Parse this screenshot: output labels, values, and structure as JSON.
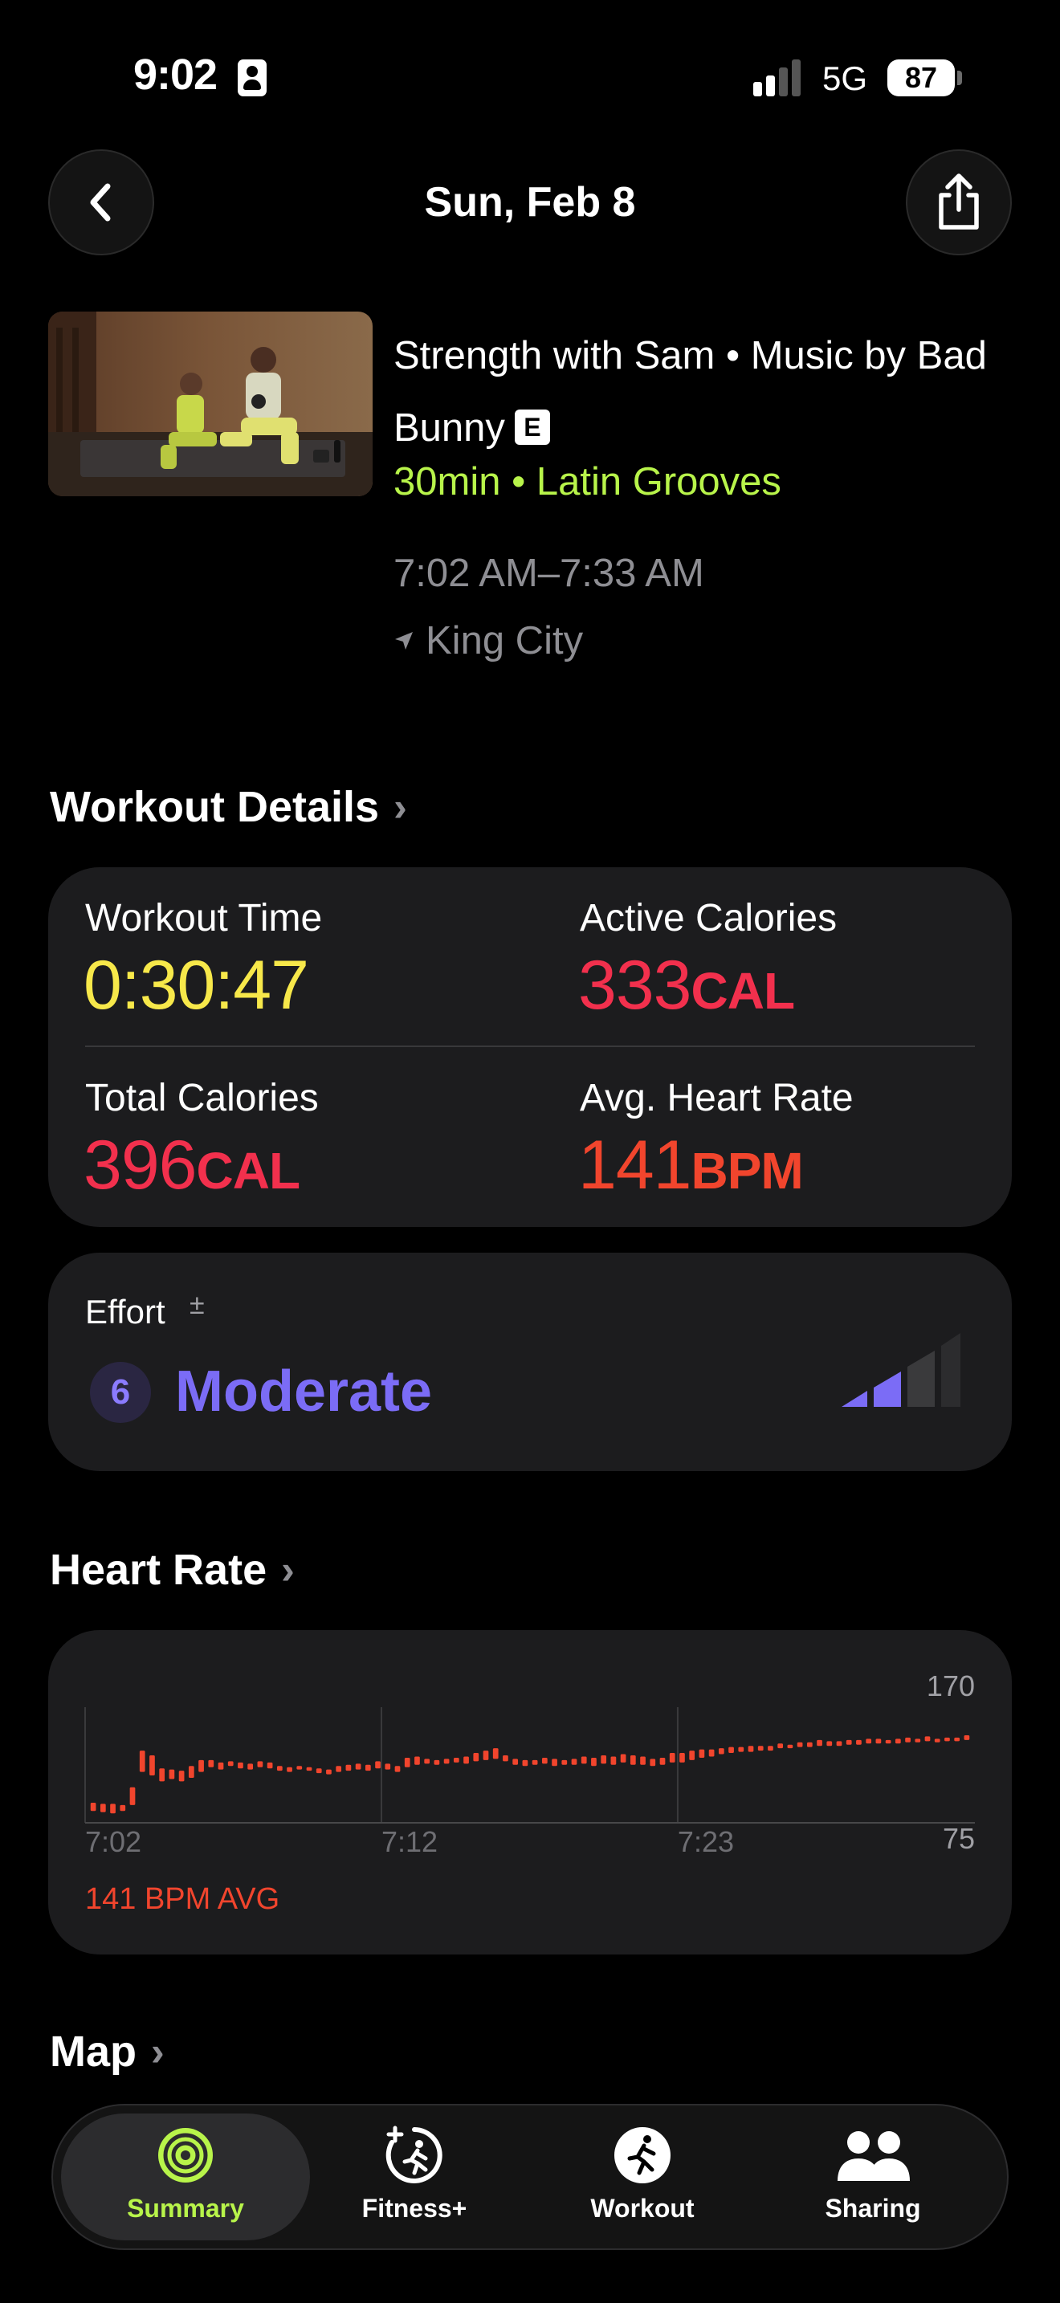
{
  "status": {
    "time": "9:02",
    "network": "5G",
    "battery": "87"
  },
  "header": {
    "title": "Sun, Feb 8"
  },
  "workout": {
    "title": "Strength with Sam • Music by Bad Bunny",
    "explicit_badge": "E",
    "meta": "30min • Latin Grooves",
    "time_range": "7:02 AM–7:33 AM",
    "location": "King City"
  },
  "details": {
    "section_title": "Workout Details",
    "workout_time_label": "Workout Time",
    "workout_time_value": "0:30:47",
    "active_cal_label": "Active Calories",
    "active_cal_value": "333",
    "active_cal_unit": "CAL",
    "total_cal_label": "Total Calories",
    "total_cal_value": "396",
    "total_cal_unit": "CAL",
    "avg_hr_label": "Avg. Heart Rate",
    "avg_hr_value": "141",
    "avg_hr_unit": "BPM"
  },
  "effort": {
    "label": "Effort",
    "symbol": "±",
    "score": "6",
    "level": "Moderate",
    "bars_filled": 2,
    "bars_total": 4
  },
  "heart_rate": {
    "section_title": "Heart Rate",
    "avg_text": "141 BPM AVG",
    "y_max": "170",
    "y_min": "75",
    "x_ticks": [
      "7:02",
      "7:12",
      "7:23"
    ]
  },
  "map": {
    "section_title": "Map"
  },
  "tabs": [
    {
      "label": "Summary",
      "icon": "activity-rings-icon",
      "active": true
    },
    {
      "label": "Fitness+",
      "icon": "fitness-plus-icon",
      "active": false
    },
    {
      "label": "Workout",
      "icon": "workout-runner-icon",
      "active": false
    },
    {
      "label": "Sharing",
      "icon": "sharing-people-icon",
      "active": false
    }
  ],
  "colors": {
    "accent_green": "#b8f44a",
    "time_yellow": "#f7e84a",
    "calories_red": "#f2304d",
    "heart_red": "#f1452d",
    "effort_purple": "#7b6cf6"
  },
  "chart_data": {
    "type": "bar",
    "title": "",
    "xlabel": "",
    "ylabel": "",
    "ylim": [
      75,
      170
    ],
    "x_tick_labels": [
      "7:02",
      "7:12",
      "7:23"
    ],
    "series": [
      {
        "values_min": [
          85,
          84,
          83,
          85,
          90,
          118,
          115,
          110,
          112,
          110,
          113,
          118,
          122,
          120,
          123,
          121,
          120,
          122,
          121,
          119,
          118,
          120,
          119,
          117,
          116,
          118,
          119,
          120,
          119,
          121,
          120,
          118,
          122,
          124,
          125,
          124,
          125,
          126,
          125,
          127,
          128,
          129,
          127,
          124,
          123,
          124,
          125,
          123,
          124,
          124,
          125,
          123,
          125,
          124,
          126,
          124,
          124,
          123,
          124,
          126,
          126,
          128,
          130,
          131,
          133,
          134,
          135,
          135,
          136,
          136,
          138,
          138,
          139,
          139,
          140,
          140,
          140,
          141,
          141,
          142,
          142,
          142,
          142,
          143,
          143,
          144,
          143,
          144,
          144,
          145
        ],
        "values_max": [
          92,
          91,
          91,
          90,
          105,
          136,
          132,
          121,
          120,
          119,
          123,
          128,
          128,
          126,
          127,
          126,
          125,
          127,
          126,
          123,
          122,
          123,
          122,
          121,
          120,
          123,
          124,
          125,
          124,
          127,
          125,
          123,
          130,
          131,
          129,
          128,
          129,
          130,
          131,
          134,
          136,
          138,
          132,
          129,
          128,
          128,
          130,
          129,
          128,
          129,
          131,
          130,
          132,
          131,
          133,
          132,
          131,
          129,
          130,
          134,
          134,
          136,
          137,
          137,
          138,
          139,
          139,
          140,
          140,
          140,
          142,
          141,
          143,
          143,
          145,
          144,
          144,
          145,
          145,
          146,
          146,
          145,
          146,
          147,
          146,
          148,
          146,
          147,
          147,
          149
        ]
      }
    ]
  }
}
